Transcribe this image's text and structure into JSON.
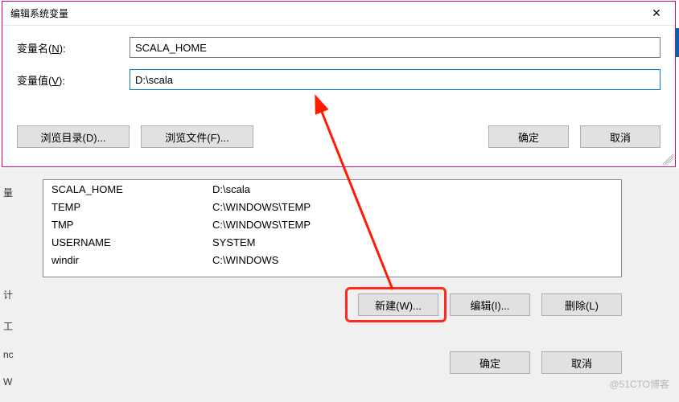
{
  "dialog": {
    "title": "编辑系统变量",
    "name_label": "变量名(N):",
    "value_label": "变量值(V):",
    "name_value": "SCALA_HOME",
    "value_value": "D:\\scala",
    "browse_dir": "浏览目录(D)...",
    "browse_file": "浏览文件(F)...",
    "ok": "确定",
    "cancel": "取消"
  },
  "env_list": [
    {
      "name": "SCALA_HOME",
      "value": "D:\\scala"
    },
    {
      "name": "TEMP",
      "value": "C:\\WINDOWS\\TEMP"
    },
    {
      "name": "TMP",
      "value": "C:\\WINDOWS\\TEMP"
    },
    {
      "name": "USERNAME",
      "value": "SYSTEM"
    },
    {
      "name": "windir",
      "value": "C:\\WINDOWS"
    }
  ],
  "buttons": {
    "new": "新建(W)...",
    "edit": "编辑(I)...",
    "delete": "删除(L)",
    "ok2": "确定",
    "cancel2": "取消"
  },
  "left_labels": {
    "a": "量",
    "b": "计",
    "c": "工",
    "d": "nc",
    "e": "W"
  },
  "watermark": "@51CTO博客"
}
